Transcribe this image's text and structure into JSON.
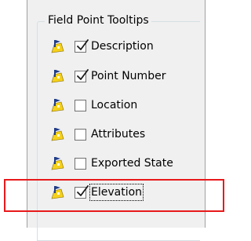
{
  "group": {
    "title": "Field Point Tooltips"
  },
  "options": [
    {
      "label": "Description",
      "checked": true,
      "icon": "field-point-icon"
    },
    {
      "label": "Point Number",
      "checked": true,
      "icon": "field-point-icon"
    },
    {
      "label": "Location",
      "checked": false,
      "icon": "field-point-icon"
    },
    {
      "label": "Attributes",
      "checked": false,
      "icon": "field-point-icon"
    },
    {
      "label": "Exported State",
      "checked": false,
      "icon": "field-point-icon"
    },
    {
      "label": "Elevation",
      "checked": true,
      "icon": "field-point-icon",
      "focused": true
    }
  ],
  "colors": {
    "panel_bg": "#f0f0f0",
    "group_border": "#d5dfe5",
    "highlight": "#e8191b",
    "icon_yellow": "#f6d11a",
    "icon_blue": "#1f3c88"
  }
}
